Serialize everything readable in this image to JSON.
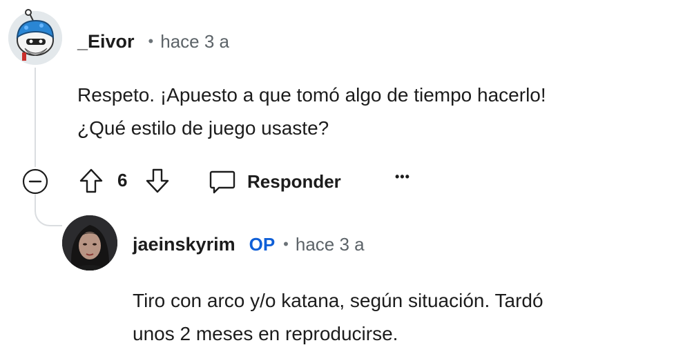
{
  "comment": {
    "author": "_Eivor",
    "time": "hace 3 a",
    "text_line1": "Respeto. ¡Apuesto a que tomó algo de tiempo hacerlo!",
    "text_line2": "¿Qué estilo de juego usaste?",
    "votes": "6",
    "reply_label": "Responder",
    "more_label": "•••"
  },
  "reply": {
    "author": "jaeinskyrim",
    "badge": "OP",
    "time": "hace 3 a",
    "text_line1": "Tiro con arco y/o katana, según situación. Tardó",
    "text_line2": "unos 2 meses en reproducirse."
  },
  "icons": {
    "collapse": "minus-circle-icon",
    "upvote": "arrow-up-icon",
    "downvote": "arrow-down-icon",
    "reply": "speech-bubble-icon",
    "more": "ellipsis-icon"
  },
  "colors": {
    "text": "#1c1c1c",
    "meta": "#5c6368",
    "op": "#0f5fd7",
    "thread": "#dadde0"
  }
}
